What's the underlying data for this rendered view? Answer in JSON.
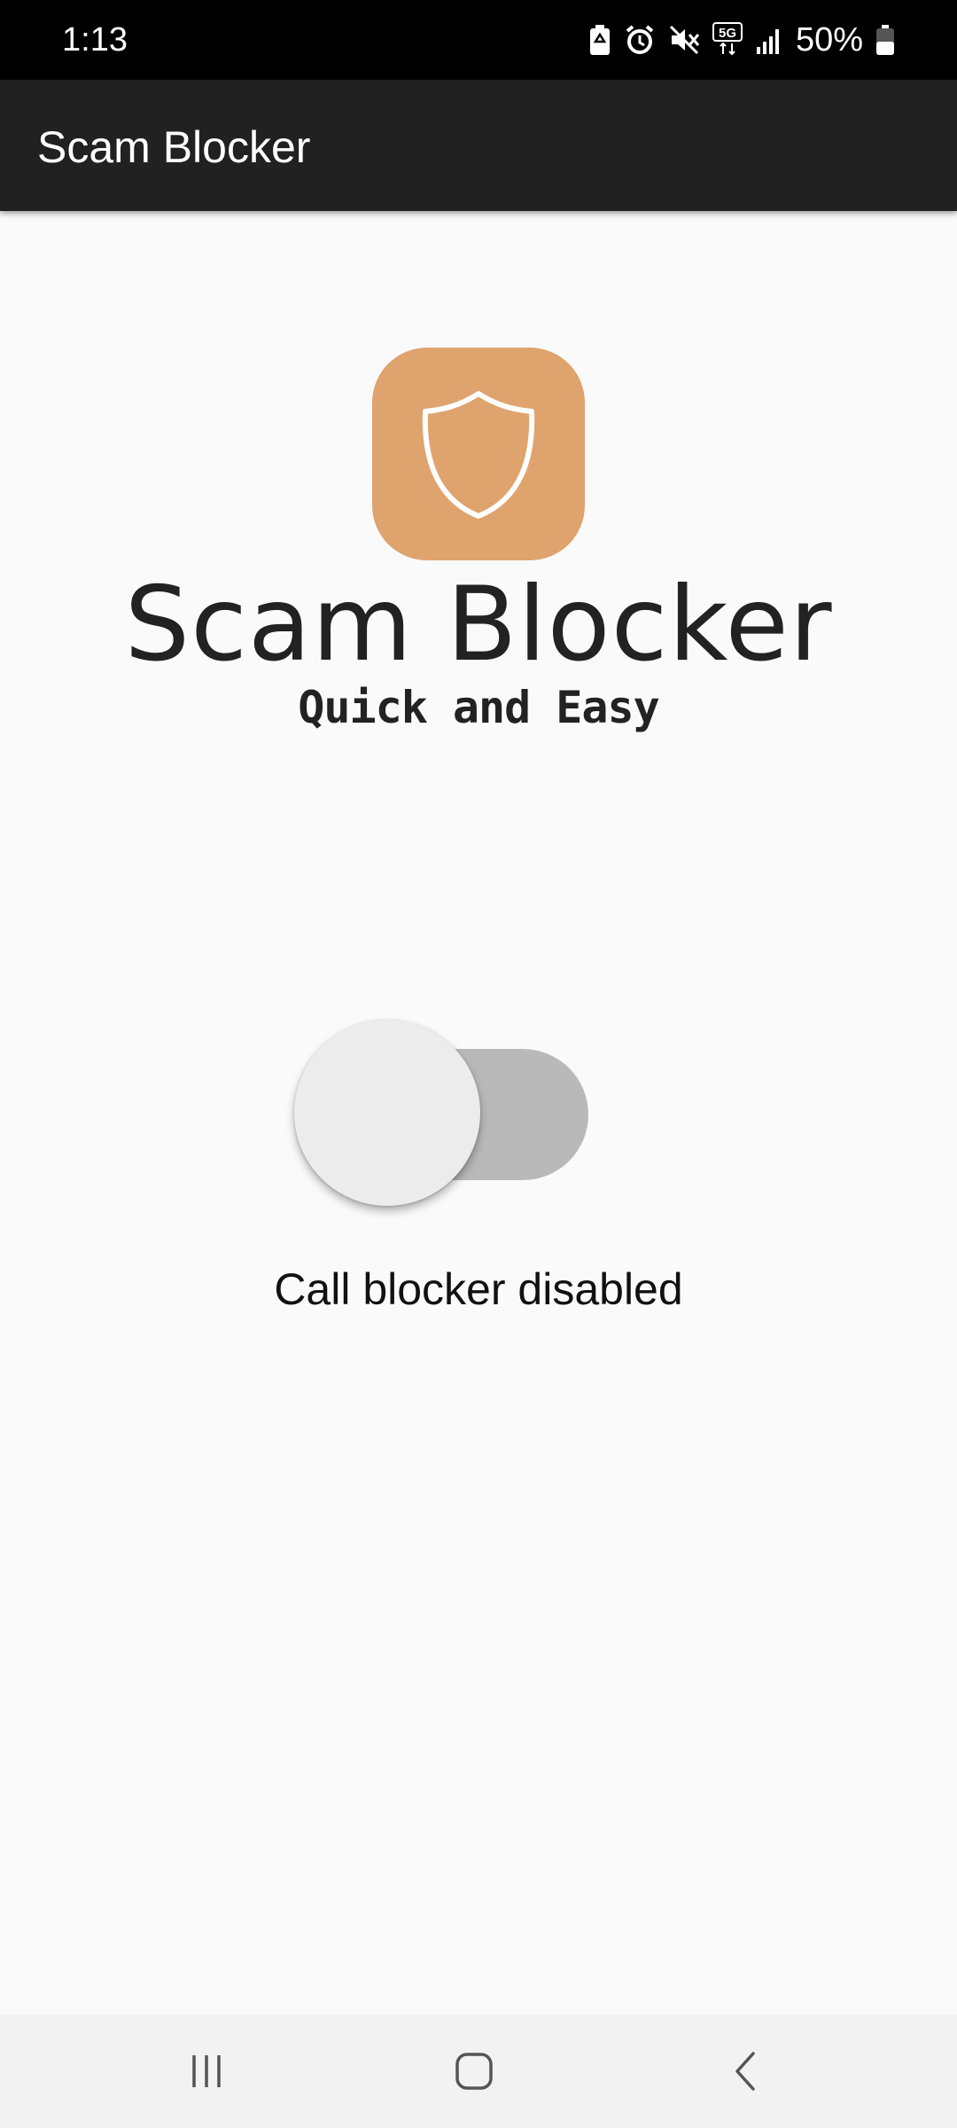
{
  "status_bar": {
    "time": "1:13",
    "battery_percent": "50%",
    "battery_level": 0.5,
    "icons": [
      "battery-saver-icon",
      "alarm-icon",
      "mute-icon",
      "5g-icon",
      "signal-icon",
      "battery-icon"
    ]
  },
  "app_bar": {
    "title": "Scam Blocker"
  },
  "logo": {
    "wordmark": "Scam Blocker",
    "tagline": "Quick and Easy",
    "tile_color": "#dfa36e",
    "icon": "shield-icon"
  },
  "blocker_switch": {
    "enabled": false,
    "caption": "Call blocker disabled"
  },
  "nav_bar": {
    "icons": [
      "recent-apps-icon",
      "home-icon",
      "back-icon"
    ]
  }
}
